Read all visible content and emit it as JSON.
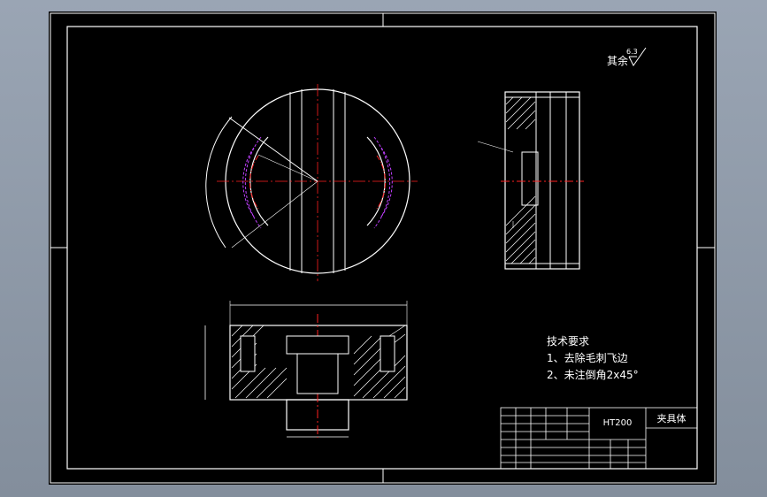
{
  "drawing": {
    "surface_finish": {
      "prefix": "其余",
      "value": "6.3"
    },
    "technical_requirements": {
      "title": "技术要求",
      "items": [
        "1、去除毛刺飞边",
        "2、未注倒角2x45°"
      ]
    },
    "title_block": {
      "material": "HT200",
      "part_name": "夹具体"
    },
    "colors": {
      "background": "#000000",
      "lines": "#ffffff",
      "center_lines": "#ff2020",
      "hidden_lines": "#c040ff",
      "hatch": "#ffffff"
    }
  }
}
